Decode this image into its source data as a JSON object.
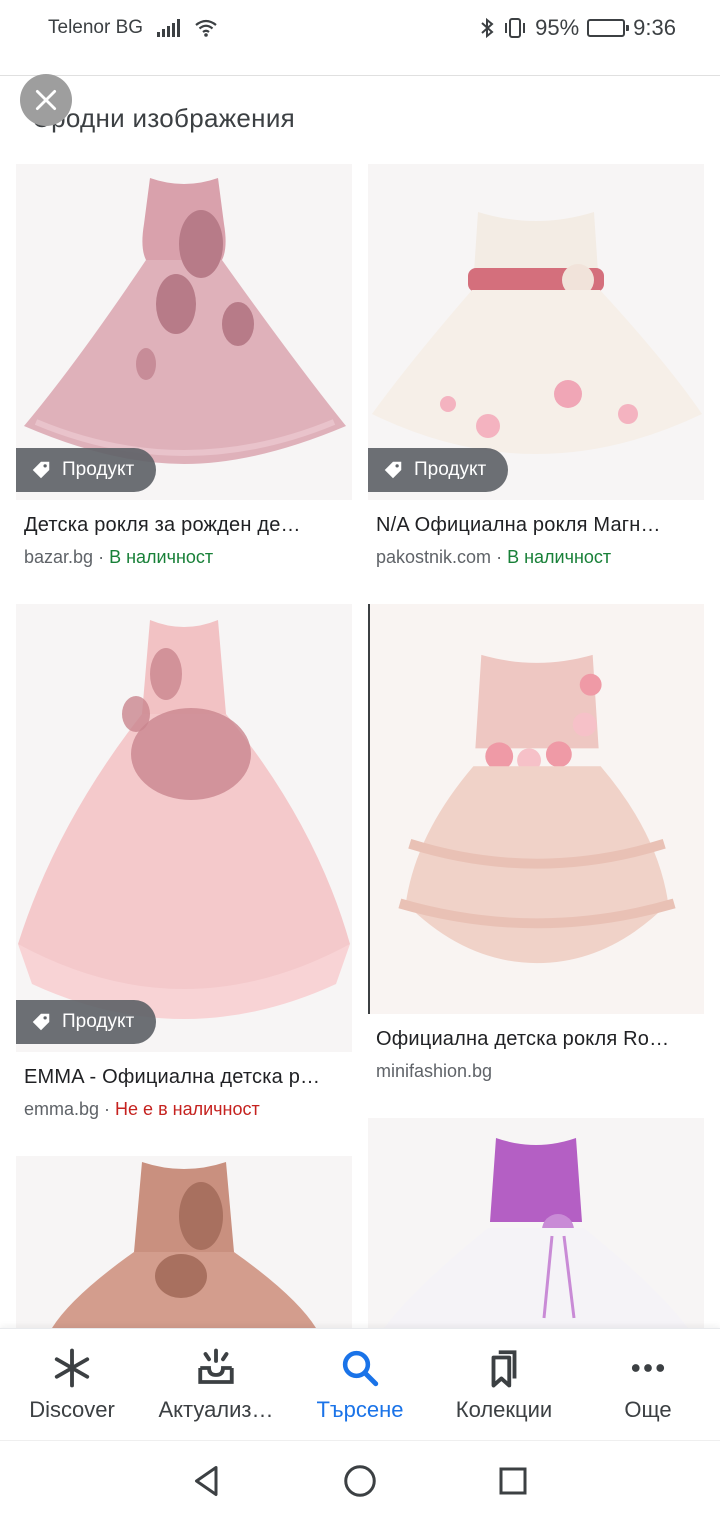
{
  "status": {
    "carrier": "Telenor BG",
    "battery": "95%",
    "battery_level": 0.95,
    "time": "9:36"
  },
  "header": {
    "close_icon": "close-icon",
    "section_title": "Сродни изображения"
  },
  "results": [
    {
      "badge": "Продукт",
      "title": "Детска рокля за рожден де…",
      "source": "bazar.bg",
      "separator": " · ",
      "availability": "В наличност",
      "availability_color": "#188038"
    },
    {
      "badge": "Продукт",
      "title": "N/A Официална рокля Магн…",
      "source": "pakostnik.com",
      "separator": " · ",
      "availability": "В наличност",
      "availability_color": "#188038"
    },
    {
      "badge": "Продукт",
      "title": "EMMA - Официална детска р…",
      "source": "emma.bg",
      "separator": " · ",
      "availability": "Не е в наличност",
      "availability_color": "#c5221f"
    },
    {
      "badge": "",
      "title": "Официална детска рокля Ro…",
      "source": "minifashion.bg",
      "separator": "",
      "availability": ""
    },
    {
      "badge": "",
      "title": "",
      "source": "",
      "separator": "",
      "availability": ""
    },
    {
      "badge": "",
      "title": "",
      "source": "",
      "separator": "",
      "availability": ""
    }
  ],
  "bottom_nav": [
    {
      "label": "Discover",
      "icon": "asterisk-icon",
      "active": false
    },
    {
      "label": "Актуализ…",
      "icon": "inbox-updates-icon",
      "active": false
    },
    {
      "label": "Търсене",
      "icon": "search-icon",
      "active": true
    },
    {
      "label": "Колекции",
      "icon": "bookmarks-icon",
      "active": false
    },
    {
      "label": "Още",
      "icon": "more-dots-icon",
      "active": false
    }
  ],
  "system_nav": [
    "back-icon",
    "home-icon",
    "recents-icon"
  ],
  "colors": {
    "accent": "#1a73e8",
    "in_stock": "#188038",
    "out_of_stock": "#c5221f",
    "badge_bg": "#5f6368"
  }
}
